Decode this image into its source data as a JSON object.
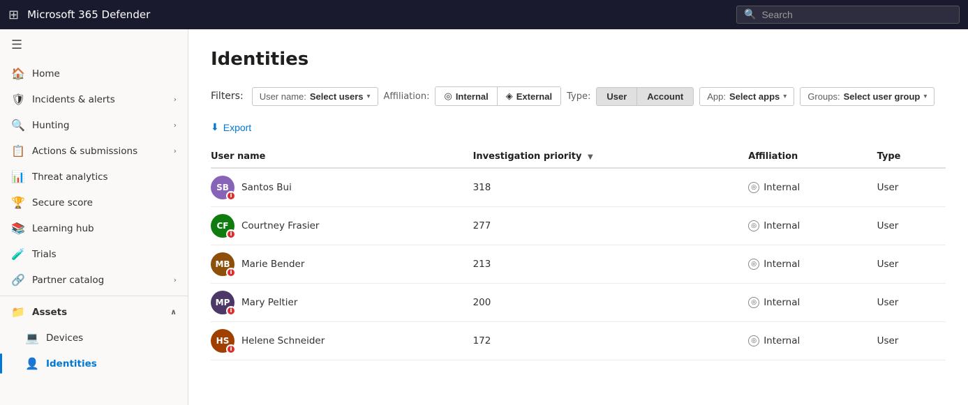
{
  "app": {
    "title": "Microsoft 365 Defender"
  },
  "search": {
    "placeholder": "Search"
  },
  "sidebar": {
    "toggle_icon": "☰",
    "items": [
      {
        "id": "home",
        "label": "Home",
        "icon": "🏠",
        "hasChevron": false,
        "active": false
      },
      {
        "id": "incidents",
        "label": "Incidents & alerts",
        "icon": "🛡",
        "hasChevron": true,
        "active": false
      },
      {
        "id": "hunting",
        "label": "Hunting",
        "icon": "🔍",
        "hasChevron": true,
        "active": false
      },
      {
        "id": "actions",
        "label": "Actions & submissions",
        "icon": "📋",
        "hasChevron": true,
        "active": false
      },
      {
        "id": "threat",
        "label": "Threat analytics",
        "icon": "📊",
        "hasChevron": false,
        "active": false
      },
      {
        "id": "secure",
        "label": "Secure score",
        "icon": "🏆",
        "hasChevron": false,
        "active": false
      },
      {
        "id": "learning",
        "label": "Learning hub",
        "icon": "📚",
        "hasChevron": false,
        "active": false
      },
      {
        "id": "trials",
        "label": "Trials",
        "icon": "🧪",
        "hasChevron": false,
        "active": false
      },
      {
        "id": "partner",
        "label": "Partner catalog",
        "icon": "🔗",
        "hasChevron": true,
        "active": false
      }
    ],
    "assets_section": "Assets",
    "assets_items": [
      {
        "id": "devices",
        "label": "Devices",
        "icon": "💻",
        "active": false
      },
      {
        "id": "identities",
        "label": "Identities",
        "icon": "👤",
        "active": true
      }
    ]
  },
  "page": {
    "title": "Identities"
  },
  "filters": {
    "label": "Filters:",
    "username_key": "User name:",
    "username_val": "Select users",
    "affiliation_key": "Affiliation:",
    "affil_internal": "Internal",
    "affil_external": "External",
    "type_key": "Type:",
    "type_user": "User",
    "type_account": "Account",
    "app_key": "App:",
    "app_val": "Select apps",
    "groups_key": "Groups:",
    "groups_val": "Select user group"
  },
  "export": {
    "label": "Export"
  },
  "table": {
    "headers": [
      {
        "id": "username",
        "label": "User name",
        "sortable": false
      },
      {
        "id": "priority",
        "label": "Investigation priority",
        "sortable": true
      },
      {
        "id": "affiliation",
        "label": "Affiliation",
        "sortable": false
      },
      {
        "id": "type",
        "label": "Type",
        "sortable": false
      }
    ],
    "rows": [
      {
        "id": "santos",
        "name": "Santos Bui",
        "initials": "SB",
        "avatar_color": "#8764b8",
        "has_avatar_img": true,
        "priority": "318",
        "affiliation": "Internal",
        "type": "User"
      },
      {
        "id": "courtney",
        "name": "Courtney Frasier",
        "initials": "CF",
        "avatar_color": "#107c10",
        "has_avatar_img": false,
        "priority": "277",
        "affiliation": "Internal",
        "type": "User"
      },
      {
        "id": "marie",
        "name": "Marie Bender",
        "initials": "MB",
        "avatar_color": "#8d4f0a",
        "has_avatar_img": false,
        "priority": "213",
        "affiliation": "Internal",
        "type": "User"
      },
      {
        "id": "mary",
        "name": "Mary Peltier",
        "initials": "MP",
        "avatar_color": "#4b3867",
        "has_avatar_img": false,
        "priority": "200",
        "affiliation": "Internal",
        "type": "User"
      },
      {
        "id": "helene",
        "name": "Helene Schneider",
        "initials": "HS",
        "avatar_color": "#a04000",
        "has_avatar_img": true,
        "priority": "172",
        "affiliation": "Internal",
        "type": "User"
      }
    ]
  }
}
